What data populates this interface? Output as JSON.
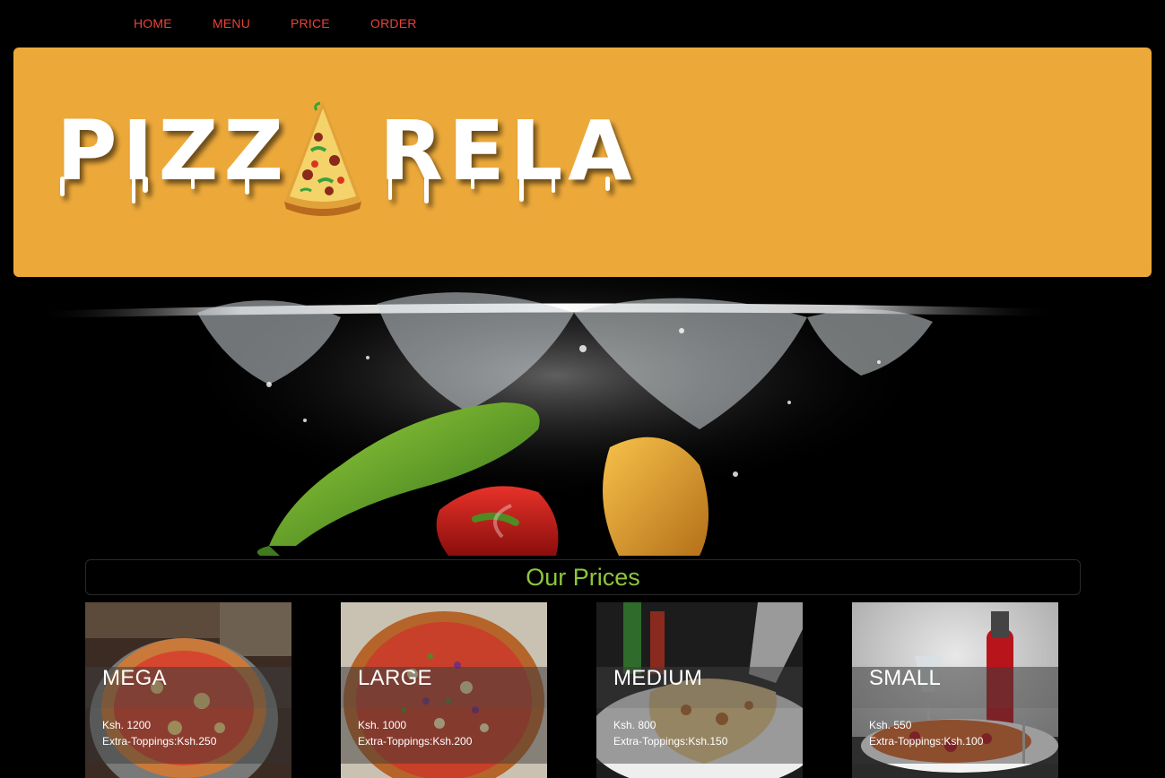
{
  "nav": {
    "items": [
      {
        "label": "HOME"
      },
      {
        "label": "MENU"
      },
      {
        "label": "PRICE"
      },
      {
        "label": "ORDER"
      }
    ]
  },
  "header": {
    "logo_left": "PIZZ",
    "logo_right": "RELA"
  },
  "prices": {
    "title": "Our Prices",
    "cards": [
      {
        "name": "MEGA",
        "price": "Ksh. 1200",
        "extra": "Extra-Toppings:Ksh.250"
      },
      {
        "name": "LARGE",
        "price": "Ksh. 1000",
        "extra": "Extra-Toppings:Ksh.200"
      },
      {
        "name": "MEDIUM",
        "price": "Ksh. 800",
        "extra": "Extra-Toppings:Ksh.150"
      },
      {
        "name": "SMALL",
        "price": "Ksh. 550",
        "extra": "Extra-Toppings:Ksh.100"
      }
    ]
  },
  "colors": {
    "nav_link": "#e8443a",
    "header_bg": "#eca93a",
    "prices_title": "#8dc63f",
    "page_bg": "#000000"
  }
}
